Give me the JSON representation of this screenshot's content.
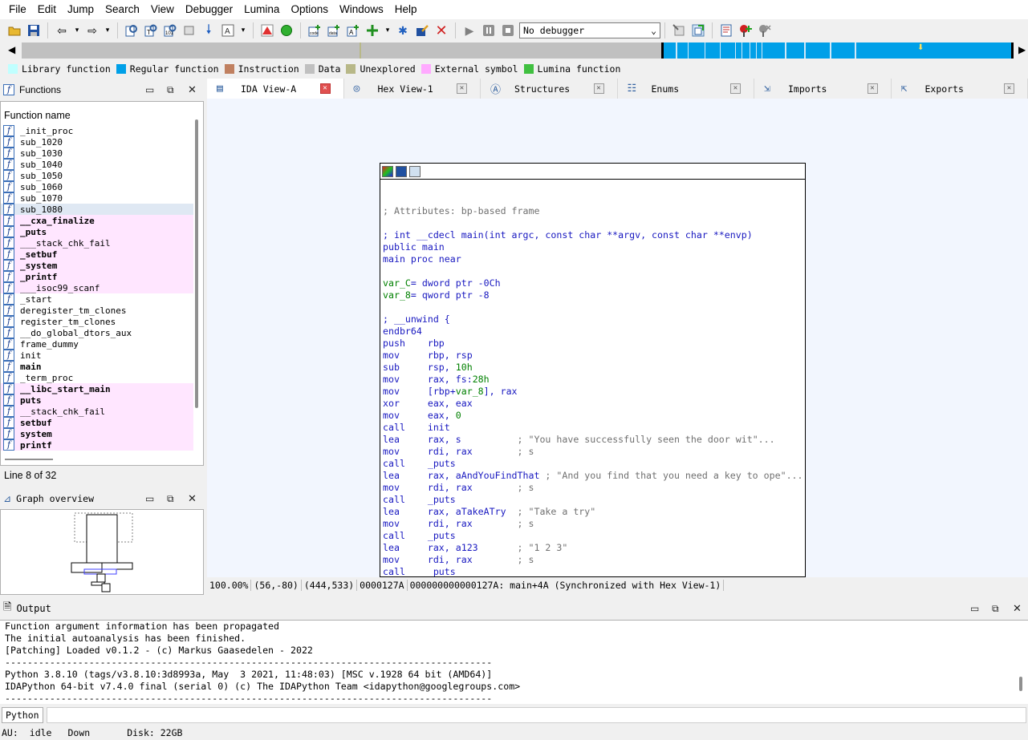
{
  "menu": [
    "File",
    "Edit",
    "Jump",
    "Search",
    "View",
    "Debugger",
    "Lumina",
    "Options",
    "Windows",
    "Help"
  ],
  "toolbar": {
    "debugger_select": "No debugger"
  },
  "legend": [
    {
      "label": "Library function",
      "color": "#c0ffff"
    },
    {
      "label": "Regular function",
      "color": "#00a0e8"
    },
    {
      "label": "Instruction",
      "color": "#c08060"
    },
    {
      "label": "Data",
      "color": "#c0c0c0"
    },
    {
      "label": "Unexplored",
      "color": "#b8b888"
    },
    {
      "label": "External symbol",
      "color": "#ffaaff"
    },
    {
      "label": "Lumina function",
      "color": "#40c040"
    }
  ],
  "functions_panel": {
    "title": "Functions",
    "column_header": "Function name",
    "line_info": "Line 8 of 32",
    "items": [
      {
        "name": "_init_proc",
        "kind": "normal"
      },
      {
        "name": "sub_1020",
        "kind": "normal"
      },
      {
        "name": "sub_1030",
        "kind": "normal"
      },
      {
        "name": "sub_1040",
        "kind": "normal"
      },
      {
        "name": "sub_1050",
        "kind": "normal"
      },
      {
        "name": "sub_1060",
        "kind": "normal"
      },
      {
        "name": "sub_1070",
        "kind": "normal"
      },
      {
        "name": "sub_1080",
        "kind": "selected"
      },
      {
        "name": "__cxa_finalize",
        "kind": "ext-bold"
      },
      {
        "name": "_puts",
        "kind": "ext-bold"
      },
      {
        "name": "___stack_chk_fail",
        "kind": "ext"
      },
      {
        "name": "_setbuf",
        "kind": "ext-bold"
      },
      {
        "name": "_system",
        "kind": "ext-bold"
      },
      {
        "name": "_printf",
        "kind": "ext-bold"
      },
      {
        "name": "___isoc99_scanf",
        "kind": "ext"
      },
      {
        "name": "_start",
        "kind": "normal"
      },
      {
        "name": "deregister_tm_clones",
        "kind": "normal"
      },
      {
        "name": "register_tm_clones",
        "kind": "normal"
      },
      {
        "name": "__do_global_dtors_aux",
        "kind": "normal"
      },
      {
        "name": "frame_dummy",
        "kind": "normal"
      },
      {
        "name": "init",
        "kind": "normal"
      },
      {
        "name": "main",
        "kind": "bold"
      },
      {
        "name": "_term_proc",
        "kind": "normal"
      },
      {
        "name": "__libc_start_main",
        "kind": "ext-bold"
      },
      {
        "name": "puts",
        "kind": "ext-bold"
      },
      {
        "name": "__stack_chk_fail",
        "kind": "ext"
      },
      {
        "name": "setbuf",
        "kind": "ext-bold"
      },
      {
        "name": "system",
        "kind": "ext-bold"
      },
      {
        "name": "printf",
        "kind": "ext-bold"
      }
    ]
  },
  "graph_overview": {
    "title": "Graph overview"
  },
  "tabs": [
    {
      "label": "IDA View-A",
      "active": true
    },
    {
      "label": "Hex View-1",
      "active": false
    },
    {
      "label": "Structures",
      "active": false
    },
    {
      "label": "Enums",
      "active": false
    },
    {
      "label": "Imports",
      "active": false
    },
    {
      "label": "Exports",
      "active": false
    }
  ],
  "code_lines": [
    {
      "parts": [
        {
          "t": "; Attributes: bp-based frame",
          "c": "cg"
        }
      ]
    },
    {
      "parts": [
        {
          "t": "",
          "c": ""
        }
      ]
    },
    {
      "parts": [
        {
          "t": "; int __cdecl main(int argc, const char **argv, const char **envp)",
          "c": "cb"
        }
      ]
    },
    {
      "parts": [
        {
          "t": "public main",
          "c": "cb"
        }
      ]
    },
    {
      "parts": [
        {
          "t": "main proc near",
          "c": "cb"
        }
      ]
    },
    {
      "parts": [
        {
          "t": "",
          "c": ""
        }
      ]
    },
    {
      "parts": [
        {
          "t": "var_C",
          "c": "cgr"
        },
        {
          "t": "= dword ptr -0Ch",
          "c": "cb"
        }
      ]
    },
    {
      "parts": [
        {
          "t": "var_8",
          "c": "cgr"
        },
        {
          "t": "= qword ptr -8",
          "c": "cb"
        }
      ]
    },
    {
      "parts": [
        {
          "t": "",
          "c": ""
        }
      ]
    },
    {
      "parts": [
        {
          "t": "; __unwind {",
          "c": "cb"
        }
      ]
    },
    {
      "parts": [
        {
          "t": "endbr64",
          "c": "cb"
        }
      ]
    },
    {
      "parts": [
        {
          "t": "push    rbp",
          "c": "cb"
        }
      ]
    },
    {
      "parts": [
        {
          "t": "mov     rbp, rsp",
          "c": "cb"
        }
      ]
    },
    {
      "parts": [
        {
          "t": "sub     rsp, ",
          "c": "cb"
        },
        {
          "t": "10h",
          "c": "cgr"
        }
      ]
    },
    {
      "parts": [
        {
          "t": "mov     rax, fs:",
          "c": "cb"
        },
        {
          "t": "28h",
          "c": "cgr"
        }
      ]
    },
    {
      "parts": [
        {
          "t": "mov     [rbp+",
          "c": "cb"
        },
        {
          "t": "var_8",
          "c": "cgr"
        },
        {
          "t": "], rax",
          "c": "cb"
        }
      ]
    },
    {
      "parts": [
        {
          "t": "xor     eax, eax",
          "c": "cb"
        }
      ]
    },
    {
      "parts": [
        {
          "t": "mov     eax, ",
          "c": "cb"
        },
        {
          "t": "0",
          "c": "cgr"
        }
      ]
    },
    {
      "parts": [
        {
          "t": "call    init",
          "c": "cb"
        }
      ]
    },
    {
      "parts": [
        {
          "t": "lea     rax, s          ",
          "c": "cb"
        },
        {
          "t": "; \"You have successfully seen the door wit\"...",
          "c": "cg"
        }
      ]
    },
    {
      "parts": [
        {
          "t": "mov     rdi, rax        ",
          "c": "cb"
        },
        {
          "t": "; s",
          "c": "cg"
        }
      ]
    },
    {
      "parts": [
        {
          "t": "call    _puts",
          "c": "cb"
        }
      ]
    },
    {
      "parts": [
        {
          "t": "lea     rax, aAndYouFindThat ",
          "c": "cb"
        },
        {
          "t": "; \"And you find that you need a key to ope\"...",
          "c": "cg"
        }
      ]
    },
    {
      "parts": [
        {
          "t": "mov     rdi, rax        ",
          "c": "cb"
        },
        {
          "t": "; s",
          "c": "cg"
        }
      ]
    },
    {
      "parts": [
        {
          "t": "call    _puts",
          "c": "cb"
        }
      ]
    },
    {
      "parts": [
        {
          "t": "lea     rax, aTakeATry  ",
          "c": "cb"
        },
        {
          "t": "; \"Take a try\"",
          "c": "cg"
        }
      ]
    },
    {
      "parts": [
        {
          "t": "mov     rdi, rax        ",
          "c": "cb"
        },
        {
          "t": "; s",
          "c": "cg"
        }
      ]
    },
    {
      "parts": [
        {
          "t": "call    _puts",
          "c": "cb"
        }
      ]
    },
    {
      "parts": [
        {
          "t": "lea     rax, a123       ",
          "c": "cb"
        },
        {
          "t": "; \"1 2 3\"",
          "c": "cg"
        }
      ]
    },
    {
      "parts": [
        {
          "t": "mov     rdi, rax        ",
          "c": "cb"
        },
        {
          "t": "; s",
          "c": "cg"
        }
      ]
    },
    {
      "parts": [
        {
          "t": "call    _puts",
          "c": "cb"
        }
      ]
    }
  ],
  "view_status": [
    "100.00%",
    "(56,-80)",
    "(444,533)",
    "0000127A",
    "000000000000127A: main+4A (Synchronized with Hex View-1)"
  ],
  "output": {
    "title": "Output",
    "lines": [
      "Function argument information has been propagated",
      "The initial autoanalysis has been finished.",
      "[Patching] Loaded v0.1.2 - (c) Markus Gaasedelen - 2022",
      "---------------------------------------------------------------------------------------",
      "Python 3.8.10 (tags/v3.8.10:3d8993a, May  3 2021, 11:48:03) [MSC v.1928 64 bit (AMD64)]",
      "IDAPython 64-bit v7.4.0 final (serial 0) (c) The IDAPython Team <idapython@googlegroups.com>",
      "---------------------------------------------------------------------------------------"
    ]
  },
  "python_button": "Python",
  "bottom_status": {
    "au_label": "AU:",
    "au_state": "idle",
    "direction": "Down",
    "disk": "Disk: 22GB"
  }
}
